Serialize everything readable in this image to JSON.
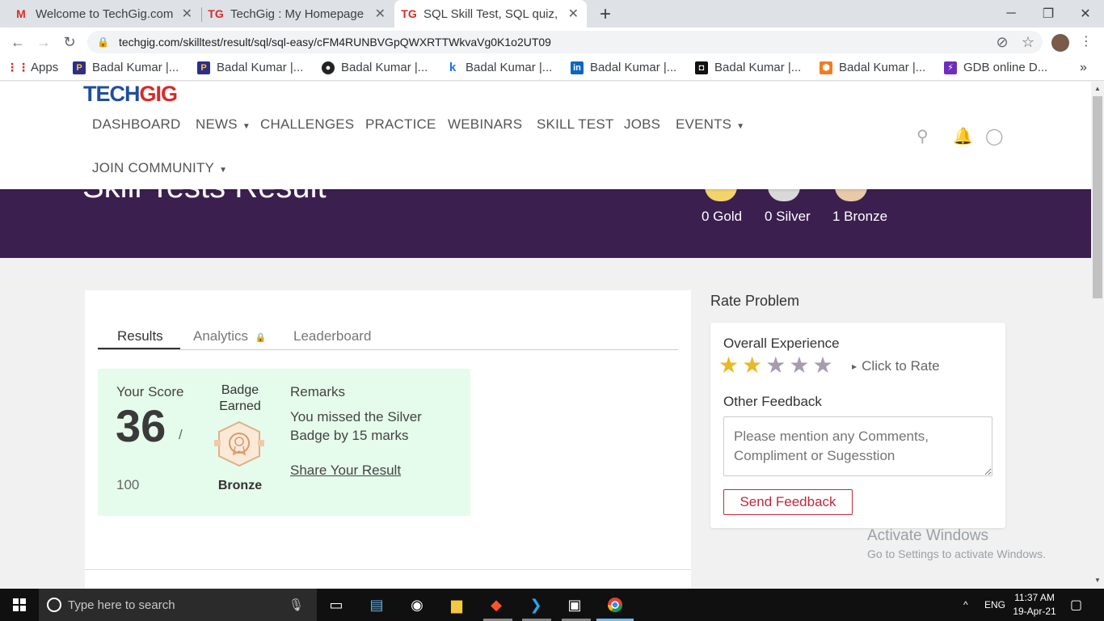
{
  "browser": {
    "tabs": [
      {
        "title": "Welcome to TechGig.com",
        "favicon": "gmail-icon"
      },
      {
        "title": "TechGig : My Homepage",
        "favicon": "techgig-icon"
      },
      {
        "title": "SQL Skill Test, SQL quiz, S",
        "favicon": "techgig-icon"
      }
    ],
    "url": "techgig.com/skilltest/result/sql/sql-easy/cFM4RUNBVGpQWXRTTWkvaVg0K1o2UT09",
    "bookmarks": [
      {
        "label": "Apps"
      },
      {
        "label": "Badal Kumar |..."
      },
      {
        "label": "Badal Kumar |..."
      },
      {
        "label": "Badal Kumar |..."
      },
      {
        "label": "Badal Kumar |..."
      },
      {
        "label": "Badal Kumar |..."
      },
      {
        "label": "Badal Kumar |..."
      },
      {
        "label": "Badal Kumar |..."
      },
      {
        "label": "GDB online D..."
      }
    ]
  },
  "site": {
    "logo_tech": "TECH",
    "logo_gig": "GIG",
    "nav": {
      "dashboard": "DASHBOARD",
      "news": "NEWS",
      "challenges": "CHALLENGES",
      "practice": "PRACTICE",
      "webinars": "WEBINARS",
      "skill_test": "SKILL TEST",
      "jobs": "JOBS",
      "events": "EVENTS",
      "join_community": "JOIN COMMUNITY"
    }
  },
  "hero": {
    "title": "Skill Tests Result",
    "medals": [
      {
        "label": "0 Gold",
        "color": "#f3d36b"
      },
      {
        "label": "0 Silver",
        "color": "#d9d9d9"
      },
      {
        "label": "1 Bronze",
        "color": "#e8c9a8"
      }
    ]
  },
  "result": {
    "tabs": {
      "results": "Results",
      "analytics": "Analytics",
      "leaderboard": "Leaderboard"
    },
    "score_label": "Your Score",
    "score": "36",
    "slash": "/",
    "total": "100",
    "badge_label": "Badge Earned",
    "badge_name": "Bronze",
    "remarks_label": "Remarks",
    "remarks_text": "You missed the Silver Badge by 15 marks",
    "share_label": "Share Your Result"
  },
  "rate": {
    "title": "Rate Problem",
    "overall_label": "Overall Experience",
    "rating": 2,
    "max_rating": 5,
    "click_to_rate": "Click to Rate",
    "other_feedback_label": "Other Feedback",
    "feedback_placeholder": "Please mention any Comments, Compliment or Sugesstion",
    "send_label": "Send Feedback"
  },
  "watermark": {
    "line1": "Activate Windows",
    "line2": "Go to Settings to activate Windows."
  },
  "taskbar": {
    "search_placeholder": "Type here to search",
    "lang": "ENG",
    "time": "11:37 AM",
    "date": "19-Apr-21"
  }
}
